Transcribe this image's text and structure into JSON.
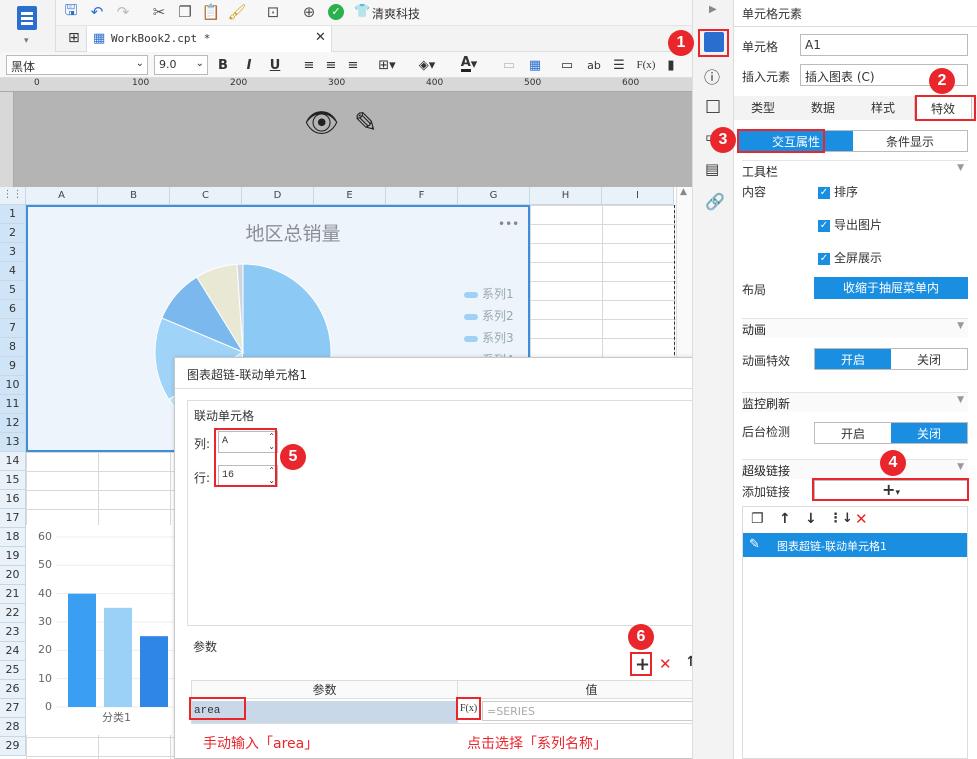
{
  "toolbar": {
    "font": "黑体",
    "size": "9.0",
    "company": "清爽科技",
    "bold": "B",
    "italic": "I",
    "underline": "U",
    "font_color_glyph": "A",
    "text_glyph": "ab",
    "formula_glyph": "F(x)"
  },
  "tab": {
    "title": "WorkBook2.cpt *"
  },
  "ruler": {
    "t0": "0",
    "t1": "100",
    "t2": "200",
    "t3": "300",
    "t4": "400",
    "t5": "500",
    "t6": "600"
  },
  "columns": [
    "A",
    "B",
    "C",
    "D",
    "E",
    "F",
    "G",
    "H",
    "I"
  ],
  "rows": [
    "1",
    "2",
    "3",
    "4",
    "5",
    "6",
    "7",
    "8",
    "9",
    "10",
    "11",
    "12",
    "13",
    "14",
    "15",
    "16",
    "17",
    "18",
    "19",
    "20",
    "21",
    "22",
    "23",
    "24",
    "25",
    "26",
    "27",
    "28",
    "29"
  ],
  "pie_chart": {
    "title": "地区总销量",
    "more": "•••",
    "legend": [
      "系列1",
      "系列2",
      "系列3",
      "系列4"
    ]
  },
  "chart_data": [
    {
      "type": "pie",
      "title": "地区总销量",
      "series": [
        {
          "name": "系列1",
          "values": [
            48,
            12,
            14,
            9,
            7,
            1
          ]
        }
      ]
    },
    {
      "type": "bar",
      "categories": [
        "分类1"
      ],
      "yticks": [
        "0",
        "10",
        "20",
        "30",
        "40",
        "50",
        "60"
      ],
      "ylim": [
        0,
        60
      ],
      "series": [
        {
          "values": [
            40
          ]
        },
        {
          "values": [
            35
          ]
        },
        {
          "values": [
            25
          ]
        }
      ]
    }
  ],
  "bar_chart": {
    "category": "分类1",
    "yticks": [
      "60",
      "50",
      "40",
      "30",
      "20",
      "10",
      "0"
    ]
  },
  "dialog": {
    "title": "图表超链-联动单元格1",
    "group_label": "联动单元格",
    "col_label": "列:",
    "col_value": "A",
    "row_label": "行:",
    "row_value": "16",
    "params_label": "参数",
    "col_param": "参数",
    "col_value_header": "值",
    "param_name": "area",
    "param_fx": "F(x)",
    "param_value": "=SERIES",
    "note_left": "手动输入「area」",
    "note_right": "点击选择「系列名称」"
  },
  "panel": {
    "title": "单元格元素",
    "cell_label": "单元格",
    "cell_value": "A1",
    "insert_label": "插入元素",
    "insert_value": "插入图表 (C)",
    "tabs": [
      "类型",
      "数据",
      "样式",
      "特效"
    ],
    "subtabs": [
      "交互属性",
      "条件显示"
    ],
    "toolbar_section": "工具栏",
    "content_label": "内容",
    "opt_sort": "排序",
    "opt_export": "导出图片",
    "opt_full": "全屏展示",
    "layout_label": "布局",
    "layout_value": "收缩于抽屉菜单内",
    "anim_section": "动画",
    "anim_label": "动画特效",
    "anim_on": "开启",
    "anim_off": "关闭",
    "monitor_section": "监控刷新",
    "monitor_label": "后台检测",
    "mon_on": "开启",
    "mon_off": "关闭",
    "link_section": "超级链接",
    "add_link": "添加链接",
    "link_item": "图表超链-联动单元格1"
  },
  "badges": [
    "1",
    "2",
    "3",
    "4",
    "5",
    "6"
  ],
  "colors": {
    "accent": "#1a8ee0",
    "red": "#e8262b",
    "header_bg": "#eaf2f9"
  }
}
